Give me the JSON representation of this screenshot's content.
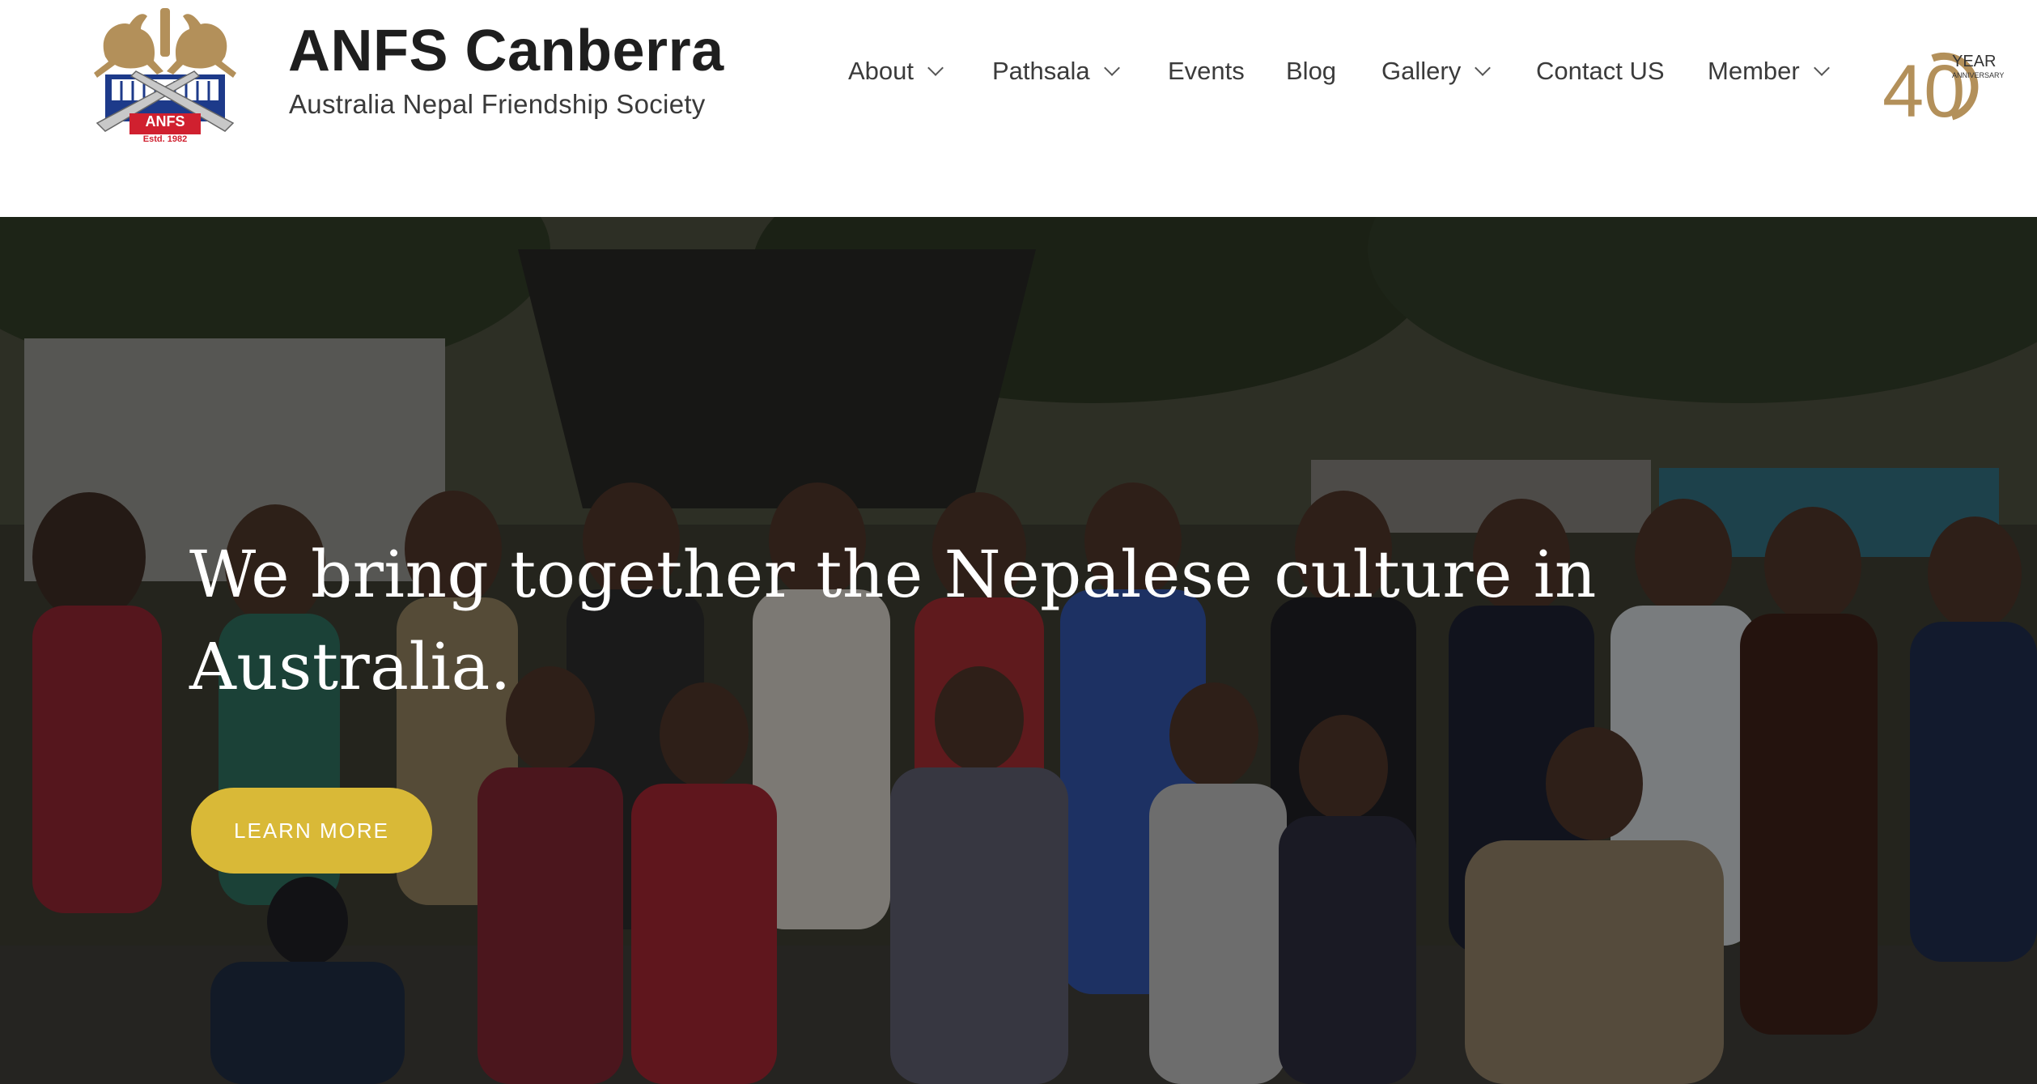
{
  "header": {
    "logo_text": "ANFS",
    "logo_est": "Estd. 1982",
    "brand_title": "ANFS Canberra",
    "brand_tagline": "Australia Nepal Friendship Society",
    "anniversary": {
      "number": "40",
      "label": "YEAR",
      "sub_label": "ANNIVERSARY"
    }
  },
  "nav": {
    "items": [
      {
        "label": "About",
        "has_dropdown": true
      },
      {
        "label": "Pathsala",
        "has_dropdown": true
      },
      {
        "label": "Events",
        "has_dropdown": false
      },
      {
        "label": "Blog",
        "has_dropdown": false
      },
      {
        "label": "Gallery",
        "has_dropdown": true
      },
      {
        "label": "Contact US",
        "has_dropdown": false
      },
      {
        "label": "Member",
        "has_dropdown": true
      }
    ]
  },
  "hero": {
    "heading": "We bring together the Nepalese culture in Australia.",
    "cta_label": "LEARN MORE"
  },
  "colors": {
    "accent": "#d9b937",
    "brand_gold": "#b3905a",
    "logo_blue": "#1d3a8a",
    "logo_red": "#d0202f",
    "text_dark": "#1e1e1e"
  }
}
